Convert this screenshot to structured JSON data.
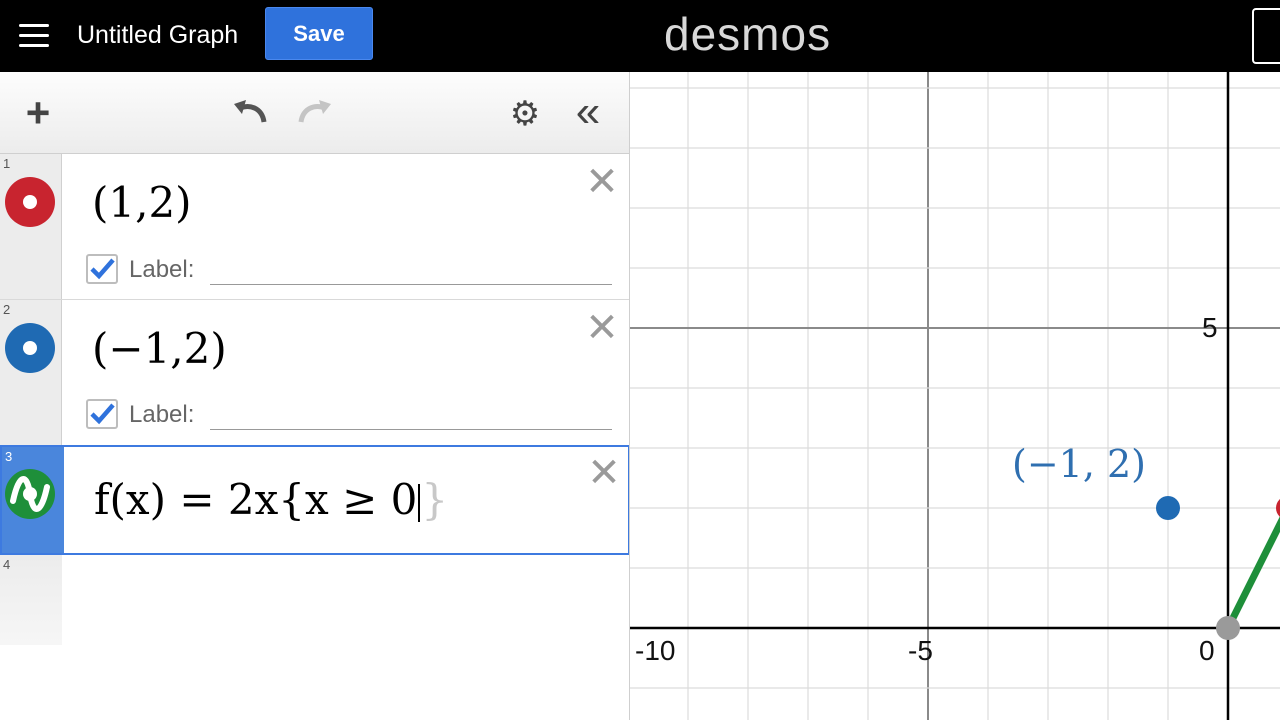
{
  "header": {
    "title": "Untitled Graph",
    "save_label": "Save",
    "logo": "desmos"
  },
  "toolbar": {
    "add_icon": "plus-icon",
    "undo_icon": "undo-icon",
    "redo_icon": "redo-icon",
    "settings_icon": "gear-icon",
    "collapse_icon": "double-chevron-left-icon"
  },
  "expressions": [
    {
      "num": "1",
      "latex": "(1,2)",
      "color": "#c8242f",
      "type": "point",
      "label_checked": true,
      "label_text": "Label:"
    },
    {
      "num": "2",
      "latex": "(−1,2)",
      "color": "#1f6ab3",
      "type": "point",
      "label_checked": true,
      "label_text": "Label:"
    },
    {
      "num": "3",
      "latex_before_caret": "f(x) = 2x{x ≥ 0",
      "latex_after_caret": "}",
      "color": "#1e8f3a",
      "type": "function"
    },
    {
      "num": "4"
    }
  ],
  "graph": {
    "x_ticks": [
      "-10",
      "-5",
      "0"
    ],
    "y_ticks": [
      "5"
    ],
    "point_label": "(−1, 2)",
    "colors": {
      "blue": "#1f6ab3",
      "green": "#1e8f3a",
      "red": "#c8242f",
      "gray": "#9a9a9a"
    }
  }
}
